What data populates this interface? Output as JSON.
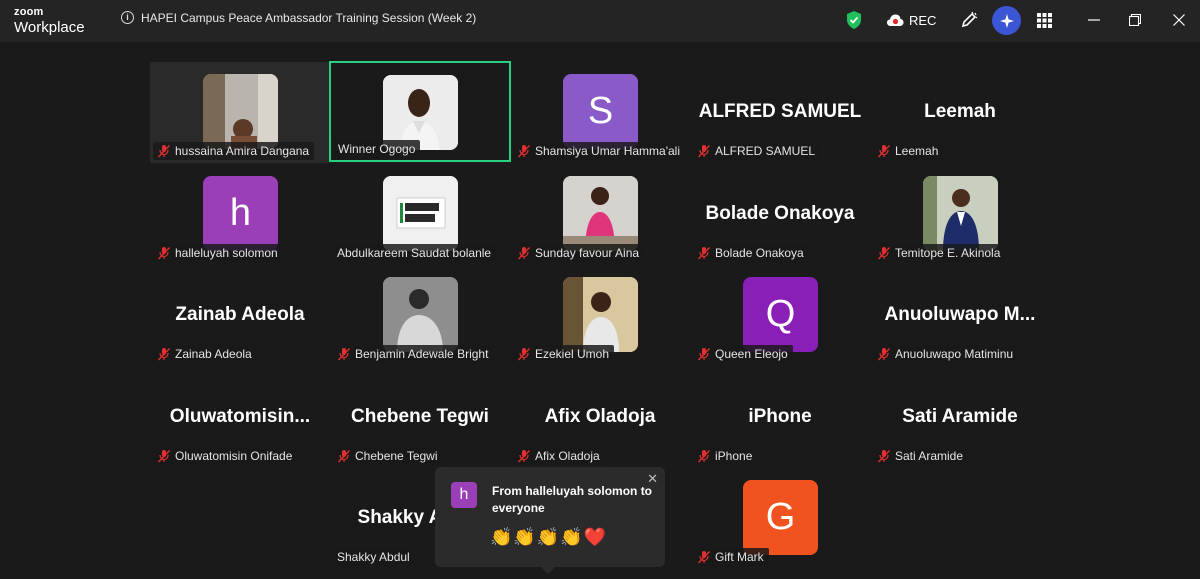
{
  "app": {
    "logo_line1": "zoom",
    "logo_line2": "Workplace"
  },
  "window": {
    "title": "HAPEI Campus Peace Ambassador Training Session (Week 2)",
    "rec_label": "REC",
    "controls": [
      "minimize",
      "restore",
      "close"
    ]
  },
  "colors": {
    "accent_green": "#26d07c",
    "rec_red": "#e02828",
    "security_green": "#20c05c"
  },
  "participants": [
    {
      "name": "hussaina Amira Dangana",
      "display": "photo",
      "muted": true
    },
    {
      "name": "Winner Ogogo",
      "display": "photo",
      "muted": false,
      "active_speaker": true
    },
    {
      "name": "Shamsiya Umar Hamma'ali",
      "display": "letter",
      "letter": "S",
      "color": "#8a5ac8",
      "muted": true
    },
    {
      "name": "ALFRED SAMUEL",
      "display": "name",
      "big_name": "ALFRED SAMUEL",
      "muted": true
    },
    {
      "name": "Leemah",
      "display": "name",
      "big_name": "Leemah",
      "muted": true
    },
    {
      "name": "halleluyah solomon",
      "display": "letter",
      "letter": "h",
      "color": "#9b3fb9",
      "muted": true
    },
    {
      "name": "Abdulkareem Saudat bolanle",
      "display": "photo",
      "muted": false
    },
    {
      "name": "Sunday favour Aina",
      "display": "photo",
      "muted": true
    },
    {
      "name": "Bolade Onakoya",
      "display": "name",
      "big_name": "Bolade Onakoya",
      "muted": true
    },
    {
      "name": "Temitope E. Akinola",
      "display": "photo",
      "muted": true
    },
    {
      "name": "Zainab Adeola",
      "display": "name",
      "big_name": "Zainab Adeola",
      "muted": true
    },
    {
      "name": "Benjamin Adewale Bright",
      "display": "photo",
      "muted": true
    },
    {
      "name": "Ezekiel Umoh",
      "display": "photo",
      "muted": true
    },
    {
      "name": "Queen Eleojo",
      "display": "letter",
      "letter": "Q",
      "color": "#8a1fb8",
      "muted": true
    },
    {
      "name": "Anuoluwapo Matiminu",
      "display": "name",
      "big_name": "Anuoluwapo  M...",
      "muted": true
    },
    {
      "name": "Oluwatomisin Onifade",
      "display": "name",
      "big_name": "Oluwatomisin...",
      "muted": true
    },
    {
      "name": "Chebene Tegwi",
      "display": "name",
      "big_name": "Chebene Tegwi",
      "muted": true
    },
    {
      "name": "Afix Oladoja",
      "display": "name",
      "big_name": "Afix Oladoja",
      "muted": true
    },
    {
      "name": "iPhone",
      "display": "name",
      "big_name": "iPhone",
      "muted": true
    },
    {
      "name": "Sati Aramide",
      "display": "name",
      "big_name": "Sati Aramide",
      "muted": true
    },
    {
      "name": "Shakky Abdul",
      "display": "name",
      "big_name": "Shakky Abdul",
      "muted": false
    },
    {
      "name": "Gift Mark",
      "display": "letter",
      "letter": "G",
      "color": "#f0531f",
      "muted": true
    }
  ],
  "chat_toast": {
    "avatar_letter": "h",
    "header": "From halleluyah solomon to everyone",
    "message": "👏👏👏👏❤️"
  }
}
